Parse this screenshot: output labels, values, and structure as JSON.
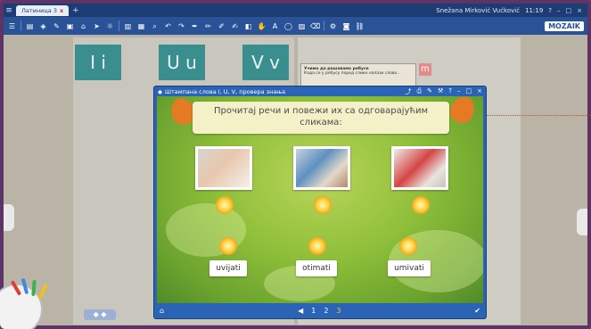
{
  "tabbar": {
    "menu_icon": "hamburger-icon",
    "tab_label": "Латиница 3",
    "tab_close": "x",
    "user": "Snežana Mirković Vućković",
    "time": "11:19",
    "right_icons": [
      "?",
      "–",
      "□",
      "×"
    ]
  },
  "toolbar": {
    "logo": "MOZAIK"
  },
  "book": {
    "letters": [
      "I i",
      "U u",
      "V v"
    ],
    "rebus_title": "Учимо да решавамо ребусе",
    "rebus_text": "Када се у ребусу поред слике налази слово…",
    "rebus_letter": "m",
    "page_nav": "◆ ◆"
  },
  "modal": {
    "title": "Штампана слова I, U, V, провера знања",
    "instruction_line1": "Прочитај речи и повежи их са одговарајућим",
    "instruction_line2": "сликама:",
    "words": [
      "uvijati",
      "otimati",
      "umivati"
    ],
    "pages": [
      "1",
      "2",
      "3"
    ],
    "current_page": "3",
    "colors": {
      "accent": "#2b63b5",
      "banner": "#f4f1c9",
      "leaf": "#e57a25"
    }
  }
}
